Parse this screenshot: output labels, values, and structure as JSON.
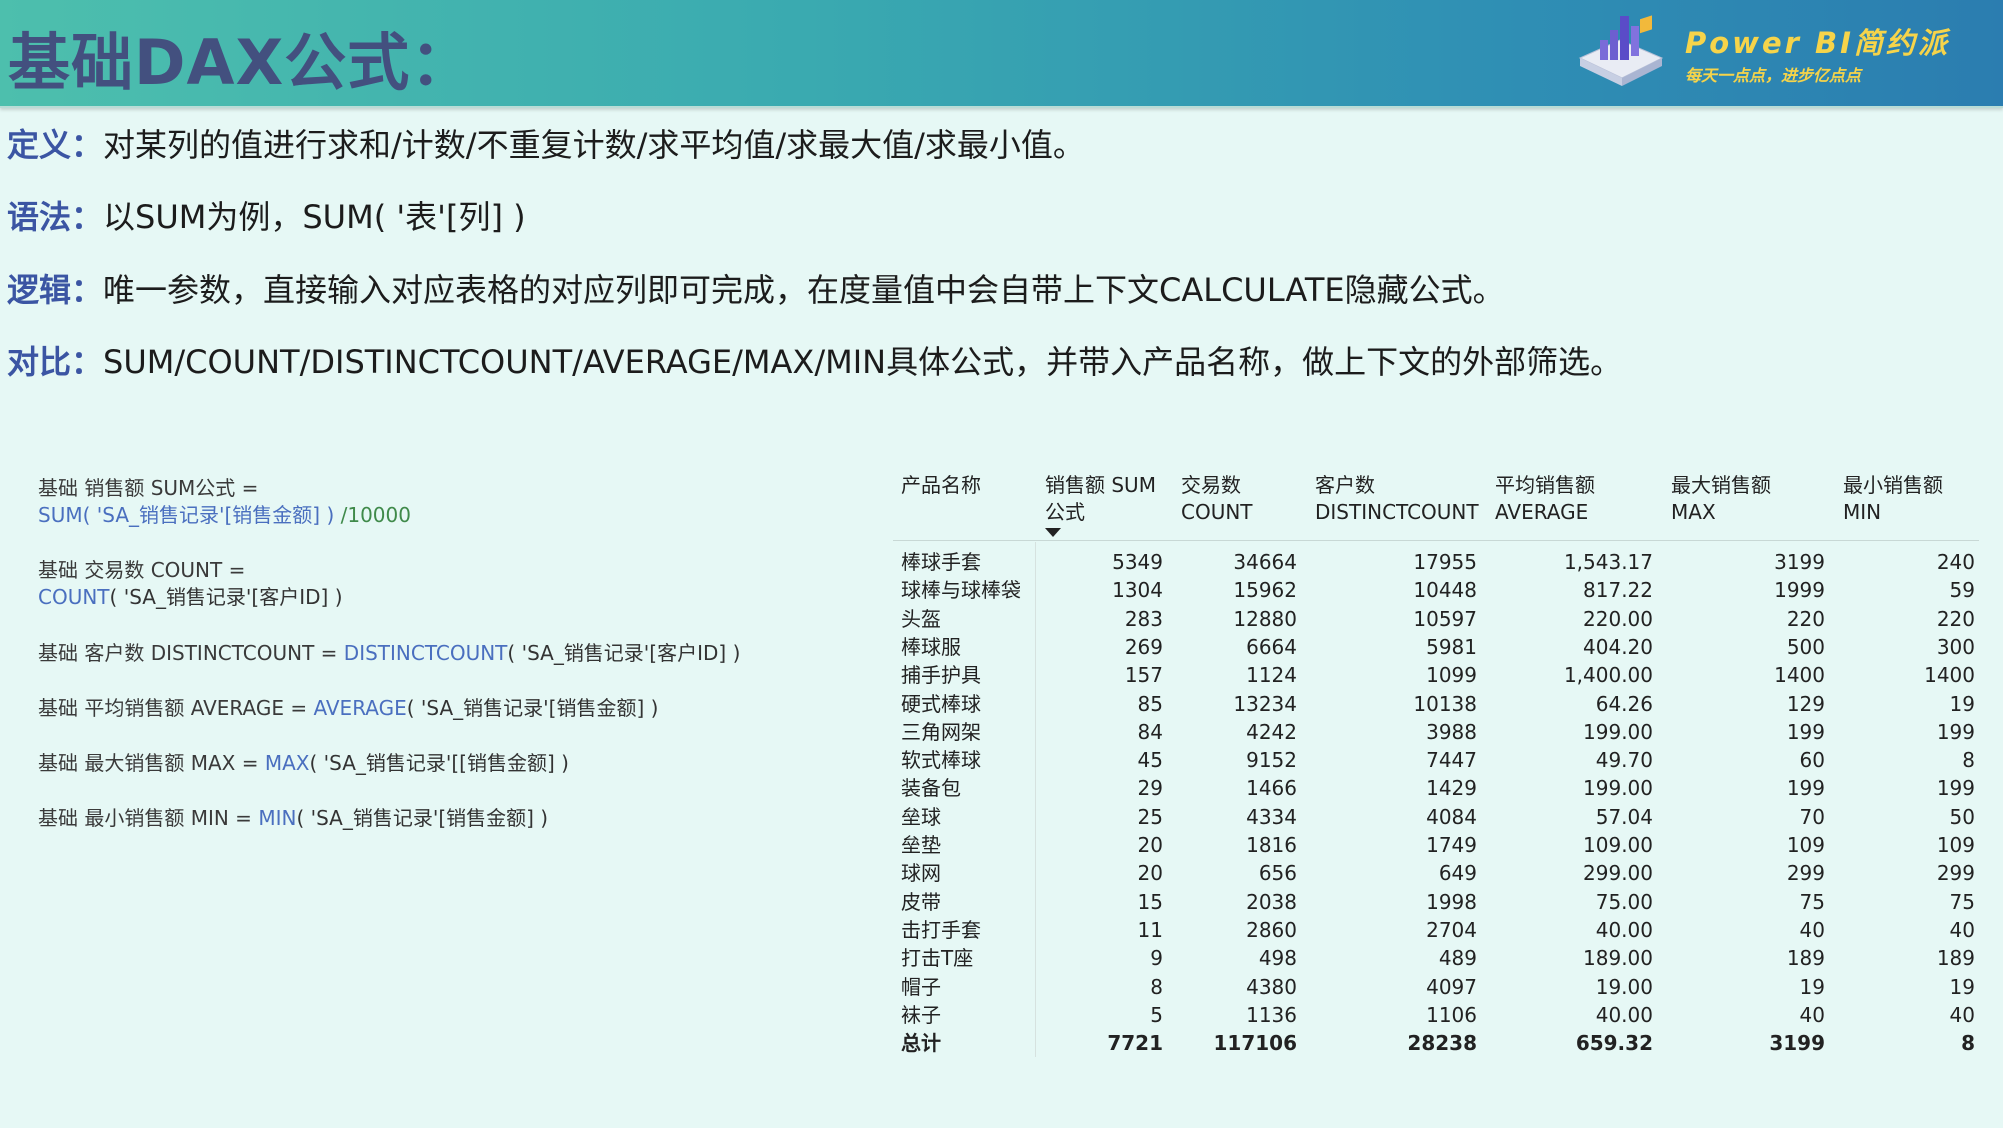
{
  "header": {
    "title": "基础DAX公式：",
    "logo_brand": "Power  BI简约派",
    "logo_slogan": "每天一点点，进步亿点点"
  },
  "definitions": [
    {
      "key": "定义：",
      "text": "对某列的值进行求和/计数/不重复计数/求平均值/求最大值/求最小值。"
    },
    {
      "key": "语法：",
      "text": "以SUM为例，SUM( '表'[列] )"
    },
    {
      "key": "逻辑：",
      "text": "唯一参数，直接输入对应表格的对应列即可完成，在度量值中会自带上下文CALCULATE隐藏公式。"
    },
    {
      "key": "对比：",
      "text": "SUM/COUNT/DISTINCTCOUNT/AVERAGE/MAX/MIN具体公式，并带入产品名称，做上下文的外部筛选。"
    }
  ],
  "formulas": [
    {
      "line1": "基础 销售额 SUM公式 =",
      "fn": "SUM",
      "arg": "( 'SA_销售记录'[销售金额] )",
      "tail": " /10000"
    },
    {
      "line1": "基础 交易数 COUNT =",
      "fn": "COUNT",
      "arg": "( 'SA_销售记录'[客户ID] )",
      "tail": ""
    },
    {
      "prefix": "基础 客户数 DISTINCTCOUNT = ",
      "fn": "DISTINCTCOUNT",
      "arg": "( 'SA_销售记录'[客户ID] )"
    },
    {
      "prefix": "基础 平均销售额 AVERAGE = ",
      "fn": "AVERAGE",
      "arg": "( 'SA_销售记录'[销售金额] )"
    },
    {
      "prefix": "基础 最大销售额 MAX = ",
      "fn": "MAX",
      "arg": "( 'SA_销售记录'[[销售金额] )"
    },
    {
      "prefix": "基础 最小销售额 MIN = ",
      "fn": "MIN",
      "arg": "( 'SA_销售记录'[销售金额] )"
    }
  ],
  "table": {
    "columns": [
      {
        "l1": "产品名称",
        "l2": ""
      },
      {
        "l1": "销售额 SUM",
        "l2": "公式"
      },
      {
        "l1": "交易数",
        "l2": "COUNT"
      },
      {
        "l1": "客户数",
        "l2": "DISTINCTCOUNT"
      },
      {
        "l1": "平均销售额",
        "l2": "AVERAGE"
      },
      {
        "l1": "最大销售额",
        "l2": "MAX"
      },
      {
        "l1": "最小销售额",
        "l2": "MIN"
      }
    ],
    "rows": [
      [
        "棒球手套",
        "5349",
        "34664",
        "17955",
        "1,543.17",
        "3199",
        "240"
      ],
      [
        "球棒与球棒袋",
        "1304",
        "15962",
        "10448",
        "817.22",
        "1999",
        "59"
      ],
      [
        "头盔",
        "283",
        "12880",
        "10597",
        "220.00",
        "220",
        "220"
      ],
      [
        "棒球服",
        "269",
        "6664",
        "5981",
        "404.20",
        "500",
        "300"
      ],
      [
        "捕手护具",
        "157",
        "1124",
        "1099",
        "1,400.00",
        "1400",
        "1400"
      ],
      [
        "硬式棒球",
        "85",
        "13234",
        "10138",
        "64.26",
        "129",
        "19"
      ],
      [
        "三角网架",
        "84",
        "4242",
        "3988",
        "199.00",
        "199",
        "199"
      ],
      [
        "软式棒球",
        "45",
        "9152",
        "7447",
        "49.70",
        "60",
        "8"
      ],
      [
        "装备包",
        "29",
        "1466",
        "1429",
        "199.00",
        "199",
        "199"
      ],
      [
        "垒球",
        "25",
        "4334",
        "4084",
        "57.04",
        "70",
        "50"
      ],
      [
        "垒垫",
        "20",
        "1816",
        "1749",
        "109.00",
        "109",
        "109"
      ],
      [
        "球网",
        "20",
        "656",
        "649",
        "299.00",
        "299",
        "299"
      ],
      [
        "皮带",
        "15",
        "2038",
        "1998",
        "75.00",
        "75",
        "75"
      ],
      [
        "击打手套",
        "11",
        "2860",
        "2704",
        "40.00",
        "40",
        "40"
      ],
      [
        "打击T座",
        "9",
        "498",
        "489",
        "189.00",
        "189",
        "189"
      ],
      [
        "帽子",
        "8",
        "4380",
        "4097",
        "19.00",
        "19",
        "19"
      ],
      [
        "袜子",
        "5",
        "1136",
        "1106",
        "40.00",
        "40",
        "40"
      ]
    ],
    "total": [
      "总计",
      "7721",
      "117106",
      "28238",
      "659.32",
      "3199",
      "8"
    ]
  }
}
